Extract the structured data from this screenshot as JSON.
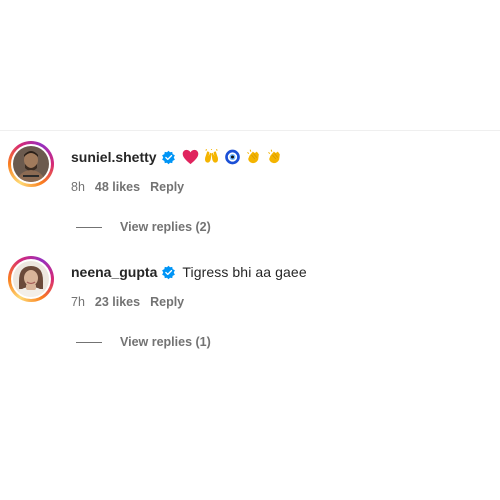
{
  "comments": [
    {
      "username": "suniel.shetty",
      "text": "",
      "emojis": [
        "red-heart",
        "raising-hands",
        "nazar-amulet",
        "clapping-hands",
        "clapping-hands"
      ],
      "time": "8h",
      "likes": "48 likes",
      "reply": "Reply",
      "view_replies": "View replies (2)"
    },
    {
      "username": "neena_gupta",
      "text": "Tigress bhi aa gaee",
      "emojis": [],
      "time": "7h",
      "likes": "23 likes",
      "reply": "Reply",
      "view_replies": "View replies (1)"
    }
  ],
  "colors": {
    "verified_blue": "#0095f6",
    "text_primary": "#262626",
    "text_secondary": "#737373"
  }
}
